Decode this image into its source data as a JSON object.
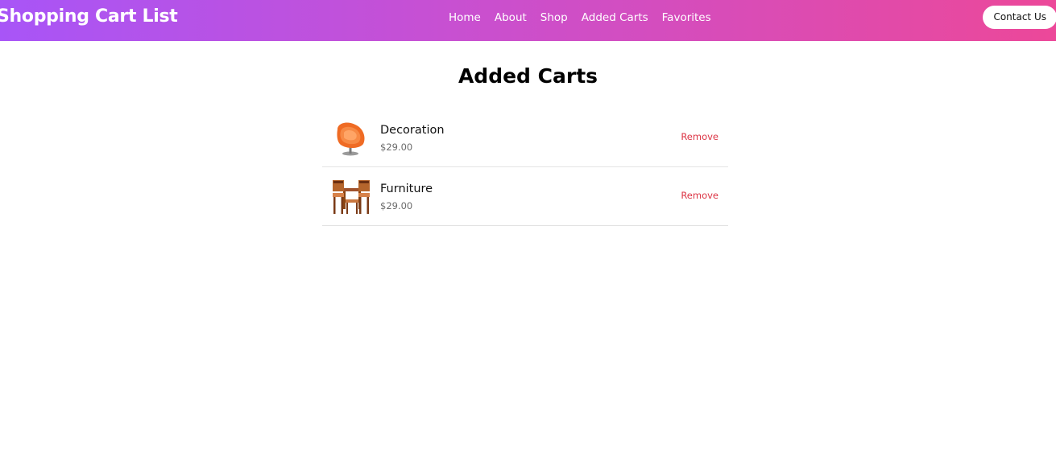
{
  "header": {
    "brand": "Shopping Cart List",
    "nav": [
      "Home",
      "About",
      "Shop",
      "Added Carts",
      "Favorites"
    ],
    "contact_label": "Contact Us"
  },
  "main": {
    "title": "Added Carts",
    "items": [
      {
        "name": "Decoration",
        "price": "$29.00",
        "remove_label": "Remove",
        "image_icon": "orange-chair-icon"
      },
      {
        "name": "Furniture",
        "price": "$29.00",
        "remove_label": "Remove",
        "image_icon": "wooden-dining-set-icon"
      }
    ]
  },
  "colors": {
    "header_gradient_start": "#a855f7",
    "header_gradient_end": "#ec4899",
    "remove_text": "#dc3545"
  }
}
